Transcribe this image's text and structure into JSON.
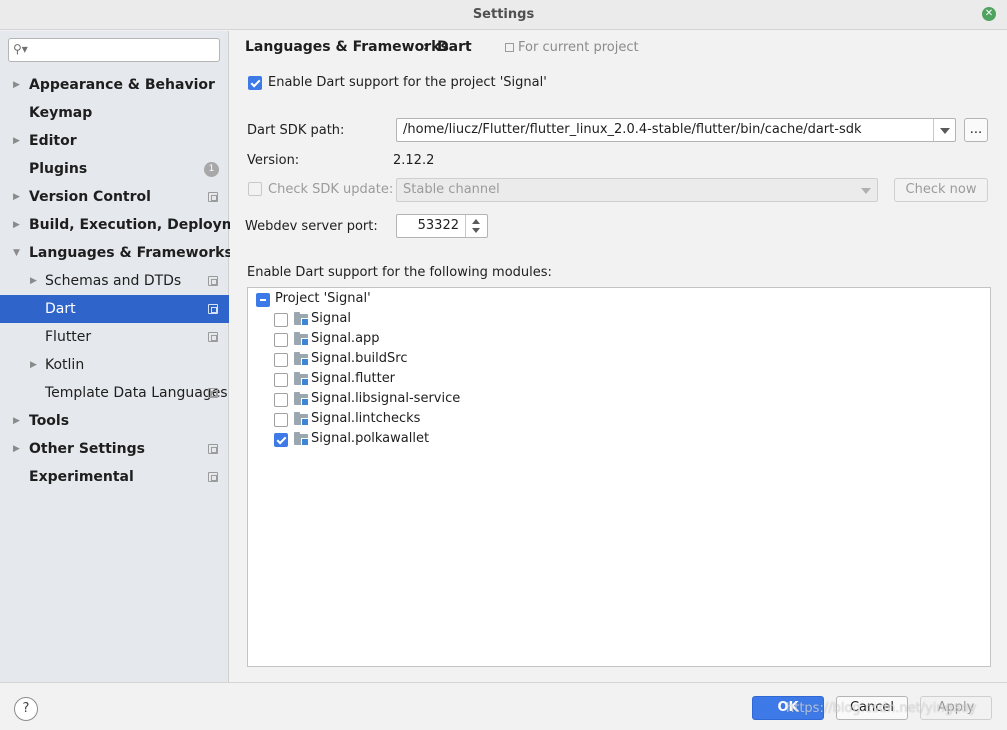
{
  "window": {
    "title": "Settings"
  },
  "search": {
    "placeholder": ""
  },
  "sidebar": {
    "items": [
      {
        "label": "Appearance & Behavior"
      },
      {
        "label": "Keymap"
      },
      {
        "label": "Editor"
      },
      {
        "label": "Plugins",
        "badge": "1"
      },
      {
        "label": "Version Control"
      },
      {
        "label": "Build, Execution, Deployment"
      },
      {
        "label": "Languages & Frameworks"
      },
      {
        "label": "Schemas and DTDs"
      },
      {
        "label": "Dart"
      },
      {
        "label": "Flutter"
      },
      {
        "label": "Kotlin"
      },
      {
        "label": "Template Data Languages"
      },
      {
        "label": "Tools"
      },
      {
        "label": "Other Settings"
      },
      {
        "label": "Experimental"
      }
    ]
  },
  "breadcrumb": {
    "parent": "Languages & Frameworks",
    "separator": "›",
    "current": "Dart",
    "scope": "For current project"
  },
  "dart": {
    "enable_label": "Enable Dart support for the project 'Signal'",
    "enabled": true,
    "sdk_path_label": "Dart SDK path:",
    "sdk_path_value": "/home/liucz/Flutter/flutter_linux_2.0.4-stable/flutter/bin/cache/dart-sdk",
    "browse_label": "...",
    "version_label": "Version:",
    "version_value": "2.12.2",
    "check_update_label": "Check SDK update:",
    "channel_value": "Stable channel",
    "check_now_label": "Check now",
    "webdev_label": "Webdev server port:",
    "webdev_port": "53322",
    "modules_label": "Enable Dart support for the following modules:"
  },
  "modules": {
    "project": "Project 'Signal'",
    "items": [
      {
        "name": "Signal",
        "checked": false
      },
      {
        "name": "Signal.app",
        "checked": false
      },
      {
        "name": "Signal.buildSrc",
        "checked": false
      },
      {
        "name": "Signal.flutter",
        "checked": false
      },
      {
        "name": "Signal.libsignal-service",
        "checked": false
      },
      {
        "name": "Signal.lintchecks",
        "checked": false
      },
      {
        "name": "Signal.polkawallet",
        "checked": true
      }
    ]
  },
  "footer": {
    "help_label": "?",
    "ok_label": "OK",
    "cancel_label": "Cancel",
    "apply_label": "Apply",
    "watermark": "https://blog.csdn.net/yingaoy"
  },
  "colors": {
    "accent": "#3d7ae8",
    "selection": "#2f65ca",
    "sidebar_bg": "#e5e8ec"
  },
  "icons": {
    "search": "search-icon",
    "close": "close-icon",
    "folder": "module-folder-icon",
    "project_scope": "project-scope-icon"
  }
}
